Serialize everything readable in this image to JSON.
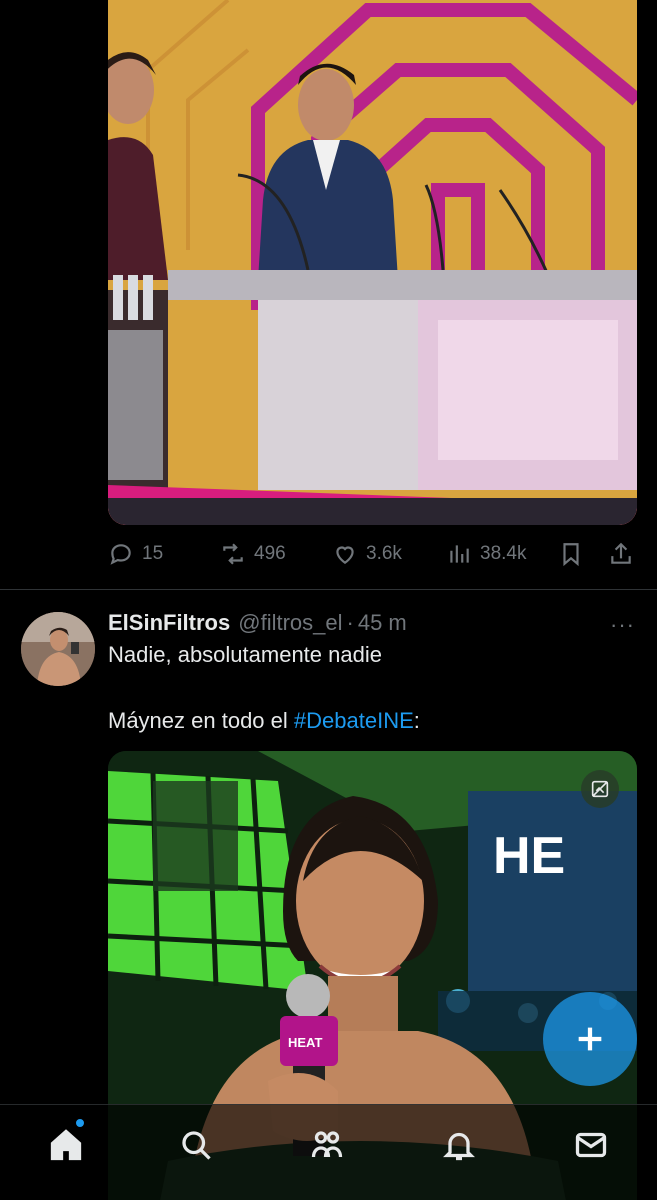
{
  "tweet1": {
    "stats": {
      "replies": "15",
      "retweets": "496",
      "likes": "3.6k",
      "views": "38.4k"
    }
  },
  "tweet2": {
    "display_name": "ElSinFiltros",
    "handle": "@filtros_el",
    "separator": "·",
    "time": "45 m",
    "more": "···",
    "text_line1": "Nadie, absolutamente nadie",
    "text_line2_prefix": "Máynez en todo el ",
    "hashtag": "#DebateINE",
    "text_line2_suffix": ":",
    "media_text": "HE",
    "mic_label": "HEAT"
  },
  "nav": {
    "items": [
      "home-icon",
      "search-icon",
      "communities-icon",
      "notifications-icon",
      "messages-icon"
    ]
  },
  "colors": {
    "accent": "#1d9bf0",
    "background": "#000000",
    "muted": "#71767b",
    "text": "#e7e9ea"
  }
}
